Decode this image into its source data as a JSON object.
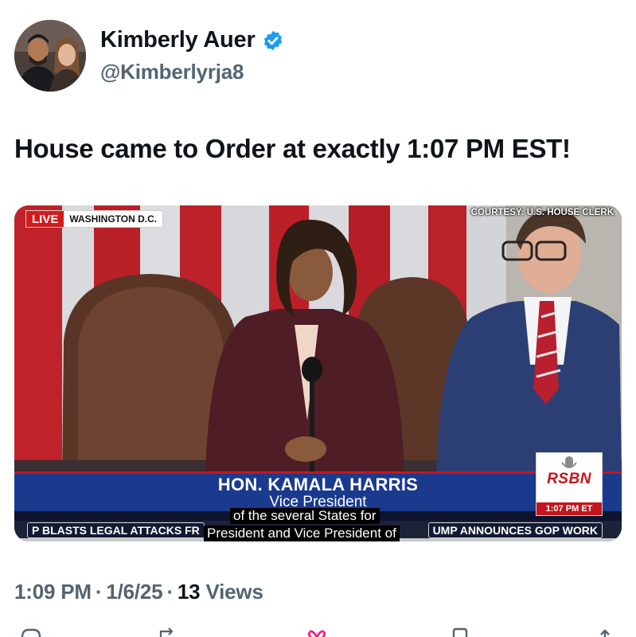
{
  "author": {
    "name": "Kimberly Auer",
    "handle": "@Kimberlyrja8",
    "verified_icon": "verified-badge-icon",
    "badge_color": "#1d9bf0"
  },
  "tweet": {
    "text": "House came to Order at exactly 1:07 PM EST!"
  },
  "media": {
    "live_label": "LIVE",
    "location": "WASHINGTON D.C.",
    "courtesy": "COURTESY: U.S. HOUSE CLERK",
    "lower_third_name": "HON. KAMALA HARRIS",
    "lower_third_title": "Vice President",
    "caption_line_1": "of the several States for",
    "caption_line_2": "President and Vice President of",
    "ticker_left": "P BLASTS LEGAL ATTACKS FR",
    "ticker_right": "UMP ANNOUNCES GOP WORK",
    "network_logo": "RSBN",
    "network_time": "1:07 PM ET"
  },
  "meta": {
    "time": "1:09 PM",
    "date": "1/6/25",
    "views_count": "13",
    "views_label": "Views"
  },
  "actions": [
    {
      "icon": "reply-icon"
    },
    {
      "icon": "retweet-icon"
    },
    {
      "icon": "like-icon"
    },
    {
      "icon": "bookmark-icon"
    },
    {
      "icon": "share-icon"
    }
  ]
}
